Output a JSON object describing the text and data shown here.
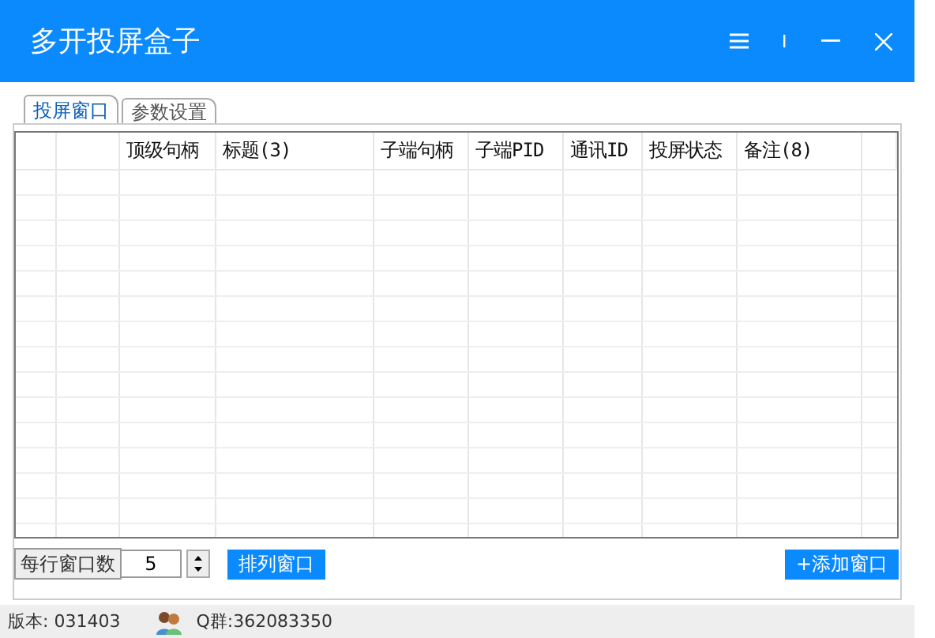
{
  "window": {
    "title": "多开投屏盒子"
  },
  "tabs": [
    {
      "label": "投屏窗口",
      "selected": true
    },
    {
      "label": "参数设置",
      "selected": false
    }
  ],
  "table": {
    "columns": [
      "顶级句柄",
      "标题(3)",
      "子端句柄",
      "子端PID",
      "通讯ID",
      "投屏状态",
      "备注(8)"
    ]
  },
  "per_row": {
    "label": "每行窗口数",
    "value": "5"
  },
  "buttons": [
    {
      "label": "排列窗口",
      "kind": "arrange"
    },
    {
      "label": "+添加窗口",
      "kind": "add"
    }
  ],
  "status_bar": {
    "version": "版本: 031403",
    "group": "Q群:362083350"
  }
}
